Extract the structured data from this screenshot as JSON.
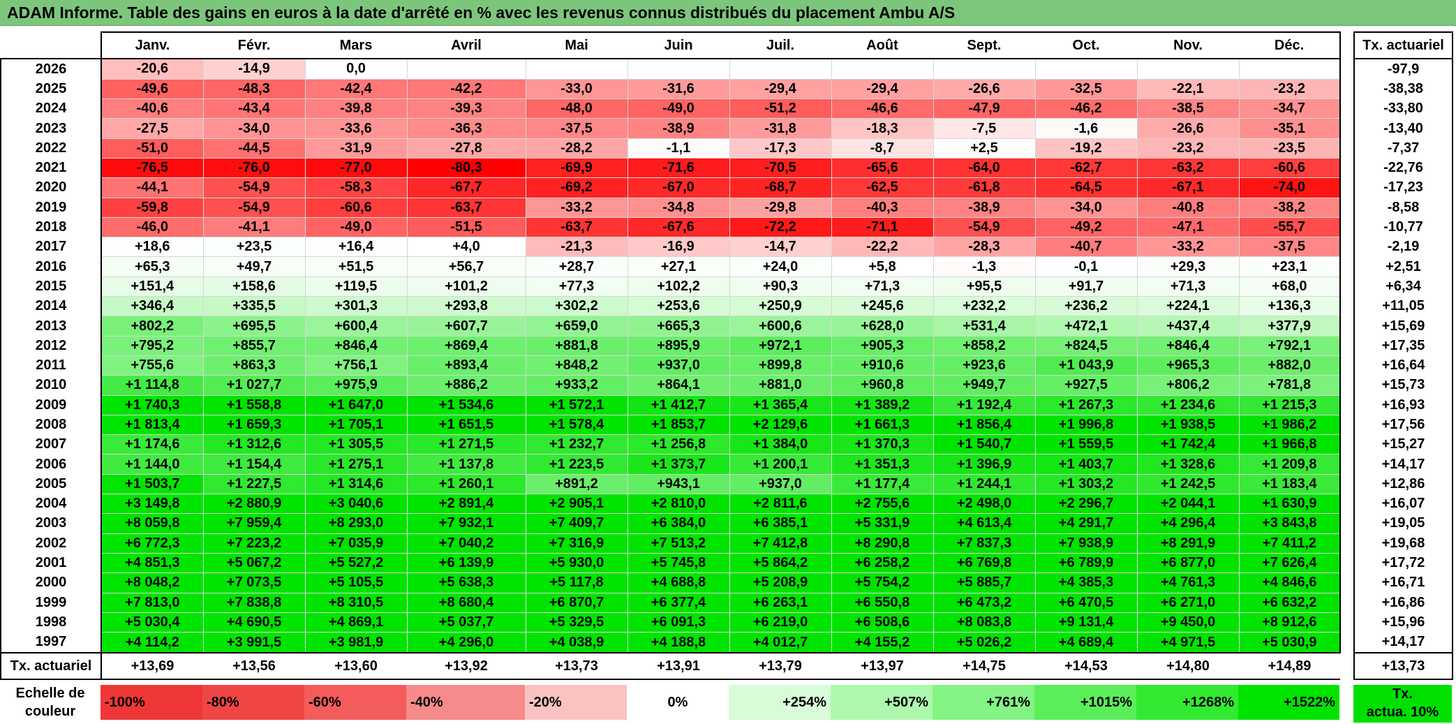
{
  "title": "ADAM Informe. Table des gains en euros à la date d'arrêté en % avec les revenus connus distribués du placement Ambu A/S",
  "months": [
    "Janv.",
    "Févr.",
    "Mars",
    "Avril",
    "Mai",
    "Juin",
    "Juil.",
    "Août",
    "Sept.",
    "Oct.",
    "Nov.",
    "Déc."
  ],
  "side_header": "Tx. actuariel",
  "rows": [
    {
      "year": "2026",
      "values": [
        "-20,6",
        "-14,9",
        "0,0",
        "",
        "",
        "",
        "",
        "",
        "",
        "",
        "",
        ""
      ],
      "tx": "-97,9"
    },
    {
      "year": "2025",
      "values": [
        "-49,6",
        "-48,3",
        "-42,4",
        "-42,2",
        "-33,0",
        "-31,6",
        "-29,4",
        "-29,4",
        "-26,6",
        "-32,5",
        "-22,1",
        "-23,2"
      ],
      "tx": "-38,38"
    },
    {
      "year": "2024",
      "values": [
        "-40,6",
        "-43,4",
        "-39,8",
        "-39,3",
        "-48,0",
        "-49,0",
        "-51,2",
        "-46,6",
        "-47,9",
        "-46,2",
        "-38,5",
        "-34,7"
      ],
      "tx": "-33,80"
    },
    {
      "year": "2023",
      "values": [
        "-27,5",
        "-34,0",
        "-33,6",
        "-36,3",
        "-37,5",
        "-38,9",
        "-31,8",
        "-18,3",
        "-7,5",
        "-1,6",
        "-26,6",
        "-35,1"
      ],
      "tx": "-13,40"
    },
    {
      "year": "2022",
      "values": [
        "-51,0",
        "-44,5",
        "-31,9",
        "-27,8",
        "-28,2",
        "-1,1",
        "-17,3",
        "-8,7",
        "+2,5",
        "-19,2",
        "-23,2",
        "-23,5"
      ],
      "tx": "-7,37"
    },
    {
      "year": "2021",
      "values": [
        "-76,5",
        "-76,0",
        "-77,0",
        "-80,3",
        "-69,9",
        "-71,6",
        "-70,5",
        "-65,6",
        "-64,0",
        "-62,7",
        "-63,2",
        "-60,6"
      ],
      "tx": "-22,76"
    },
    {
      "year": "2020",
      "values": [
        "-44,1",
        "-54,9",
        "-58,3",
        "-67,7",
        "-69,2",
        "-67,0",
        "-68,7",
        "-62,5",
        "-61,8",
        "-64,5",
        "-67,1",
        "-74,0"
      ],
      "tx": "-17,23"
    },
    {
      "year": "2019",
      "values": [
        "-59,8",
        "-54,9",
        "-60,6",
        "-63,7",
        "-33,2",
        "-34,8",
        "-29,8",
        "-40,3",
        "-38,9",
        "-34,0",
        "-40,8",
        "-38,2"
      ],
      "tx": "-8,58"
    },
    {
      "year": "2018",
      "values": [
        "-46,0",
        "-41,1",
        "-49,0",
        "-51,5",
        "-63,7",
        "-67,6",
        "-72,2",
        "-71,1",
        "-54,9",
        "-49,2",
        "-47,1",
        "-55,7"
      ],
      "tx": "-10,77"
    },
    {
      "year": "2017",
      "values": [
        "+18,6",
        "+23,5",
        "+16,4",
        "+4,0",
        "-21,3",
        "-16,9",
        "-14,7",
        "-22,2",
        "-28,3",
        "-40,7",
        "-33,2",
        "-37,5"
      ],
      "tx": "-2,19"
    },
    {
      "year": "2016",
      "values": [
        "+65,3",
        "+49,7",
        "+51,5",
        "+56,7",
        "+28,7",
        "+27,1",
        "+24,0",
        "+5,8",
        "-1,3",
        "-0,1",
        "+29,3",
        "+23,1"
      ],
      "tx": "+2,51"
    },
    {
      "year": "2015",
      "values": [
        "+151,4",
        "+158,6",
        "+119,5",
        "+101,2",
        "+77,3",
        "+102,2",
        "+90,3",
        "+71,3",
        "+95,5",
        "+91,7",
        "+71,3",
        "+68,0"
      ],
      "tx": "+6,34"
    },
    {
      "year": "2014",
      "values": [
        "+346,4",
        "+335,5",
        "+301,3",
        "+293,8",
        "+302,2",
        "+253,6",
        "+250,9",
        "+245,6",
        "+232,2",
        "+236,2",
        "+224,1",
        "+136,3"
      ],
      "tx": "+11,05"
    },
    {
      "year": "2013",
      "values": [
        "+802,2",
        "+695,5",
        "+600,4",
        "+607,7",
        "+659,0",
        "+665,3",
        "+600,6",
        "+628,0",
        "+531,4",
        "+472,1",
        "+437,4",
        "+377,9"
      ],
      "tx": "+15,69"
    },
    {
      "year": "2012",
      "values": [
        "+795,2",
        "+855,7",
        "+846,4",
        "+869,4",
        "+881,8",
        "+895,9",
        "+972,1",
        "+905,3",
        "+858,2",
        "+824,5",
        "+846,4",
        "+792,1"
      ],
      "tx": "+17,35"
    },
    {
      "year": "2011",
      "values": [
        "+755,6",
        "+863,3",
        "+756,1",
        "+893,4",
        "+848,2",
        "+937,0",
        "+899,8",
        "+910,6",
        "+923,6",
        "+1 043,9",
        "+965,3",
        "+882,0"
      ],
      "tx": "+16,64"
    },
    {
      "year": "2010",
      "values": [
        "+1 114,8",
        "+1 027,7",
        "+975,9",
        "+886,2",
        "+933,2",
        "+864,1",
        "+881,0",
        "+960,8",
        "+949,7",
        "+927,5",
        "+806,2",
        "+781,8"
      ],
      "tx": "+15,73"
    },
    {
      "year": "2009",
      "values": [
        "+1 740,3",
        "+1 558,8",
        "+1 647,0",
        "+1 534,6",
        "+1 572,1",
        "+1 412,7",
        "+1 365,4",
        "+1 389,2",
        "+1 192,4",
        "+1 267,3",
        "+1 234,6",
        "+1 215,3"
      ],
      "tx": "+16,93"
    },
    {
      "year": "2008",
      "values": [
        "+1 813,4",
        "+1 659,3",
        "+1 705,1",
        "+1 651,5",
        "+1 578,4",
        "+1 853,7",
        "+2 129,6",
        "+1 661,3",
        "+1 856,4",
        "+1 996,8",
        "+1 938,5",
        "+1 986,2"
      ],
      "tx": "+17,56"
    },
    {
      "year": "2007",
      "values": [
        "+1 174,6",
        "+1 312,6",
        "+1 305,5",
        "+1 271,5",
        "+1 232,7",
        "+1 256,8",
        "+1 384,0",
        "+1 370,3",
        "+1 540,7",
        "+1 559,5",
        "+1 742,4",
        "+1 966,8"
      ],
      "tx": "+15,27"
    },
    {
      "year": "2006",
      "values": [
        "+1 144,0",
        "+1 154,4",
        "+1 275,1",
        "+1 137,8",
        "+1 223,5",
        "+1 373,7",
        "+1 200,1",
        "+1 351,3",
        "+1 396,9",
        "+1 403,7",
        "+1 328,6",
        "+1 209,8"
      ],
      "tx": "+14,17"
    },
    {
      "year": "2005",
      "values": [
        "+1 503,7",
        "+1 227,5",
        "+1 314,6",
        "+1 260,1",
        "+891,2",
        "+943,1",
        "+937,0",
        "+1 177,4",
        "+1 244,1",
        "+1 303,2",
        "+1 242,5",
        "+1 183,4"
      ],
      "tx": "+12,86"
    },
    {
      "year": "2004",
      "values": [
        "+3 149,8",
        "+2 880,9",
        "+3 040,6",
        "+2 891,4",
        "+2 905,1",
        "+2 810,0",
        "+2 811,6",
        "+2 755,6",
        "+2 498,0",
        "+2 296,7",
        "+2 044,1",
        "+1 630,9"
      ],
      "tx": "+16,07"
    },
    {
      "year": "2003",
      "values": [
        "+8 059,8",
        "+7 959,4",
        "+8 293,0",
        "+7 932,1",
        "+7 409,7",
        "+6 384,0",
        "+6 385,1",
        "+5 331,9",
        "+4 613,4",
        "+4 291,7",
        "+4 296,4",
        "+3 843,8"
      ],
      "tx": "+19,05"
    },
    {
      "year": "2002",
      "values": [
        "+6 772,3",
        "+7 223,2",
        "+7 035,9",
        "+7 040,2",
        "+7 316,9",
        "+7 513,2",
        "+7 412,8",
        "+8 290,8",
        "+7 837,3",
        "+7 938,9",
        "+8 291,9",
        "+7 411,2"
      ],
      "tx": "+19,68"
    },
    {
      "year": "2001",
      "values": [
        "+4 851,3",
        "+5 067,2",
        "+5 527,2",
        "+6 139,9",
        "+5 930,0",
        "+5 745,8",
        "+5 864,2",
        "+6 258,2",
        "+6 769,8",
        "+6 789,9",
        "+6 877,0",
        "+7 626,4"
      ],
      "tx": "+17,72"
    },
    {
      "year": "2000",
      "values": [
        "+8 048,2",
        "+7 073,5",
        "+5 105,5",
        "+5 638,3",
        "+5 117,8",
        "+4 688,8",
        "+5 208,9",
        "+5 754,2",
        "+5 885,7",
        "+4 385,3",
        "+4 761,3",
        "+4 846,6"
      ],
      "tx": "+16,71"
    },
    {
      "year": "1999",
      "values": [
        "+7 813,0",
        "+7 838,8",
        "+8 310,5",
        "+8 680,4",
        "+6 870,7",
        "+6 377,4",
        "+6 263,1",
        "+6 550,8",
        "+6 473,2",
        "+6 470,5",
        "+6 271,0",
        "+6 632,2"
      ],
      "tx": "+16,86"
    },
    {
      "year": "1998",
      "values": [
        "+5 030,4",
        "+4 690,5",
        "+4 869,1",
        "+5 037,7",
        "+5 329,5",
        "+6 091,3",
        "+6 219,0",
        "+6 508,6",
        "+8 083,8",
        "+9 131,4",
        "+9 450,0",
        "+8 912,6"
      ],
      "tx": "+15,96"
    },
    {
      "year": "1997",
      "values": [
        "+4 114,2",
        "+3 991,5",
        "+3 981,9",
        "+4 296,0",
        "+4 038,9",
        "+4 188,8",
        "+4 012,7",
        "+4 155,2",
        "+5 026,2",
        "+4 689,4",
        "+4 971,5",
        "+5 030,9"
      ],
      "tx": "+14,17"
    }
  ],
  "footer": {
    "label": "Tx. actuariel",
    "values": [
      "+13,69",
      "+13,56",
      "+13,60",
      "+13,92",
      "+13,73",
      "+13,91",
      "+13,79",
      "+13,97",
      "+14,75",
      "+14,53",
      "+14,80",
      "+14,89"
    ],
    "tx": "+13,73"
  },
  "legend": {
    "label": "Echelle de couleur",
    "steps": [
      {
        "text": "-100%",
        "color": "#ef3737",
        "align": "l"
      },
      {
        "text": "-80%",
        "color": "#f04545",
        "align": "l"
      },
      {
        "text": "-60%",
        "color": "#f45c5c",
        "align": "l"
      },
      {
        "text": "-40%",
        "color": "#f78a8a",
        "align": "l"
      },
      {
        "text": "-20%",
        "color": "#fbc2c2",
        "align": "l"
      },
      {
        "text": "0%",
        "color": "#ffffff",
        "align": "c"
      },
      {
        "text": "+254%",
        "color": "#d8fcd8",
        "align": "r"
      },
      {
        "text": "+507%",
        "color": "#aef8ae",
        "align": "r"
      },
      {
        "text": "+761%",
        "color": "#84f484",
        "align": "r"
      },
      {
        "text": "+1015%",
        "color": "#5aef5a",
        "align": "r"
      },
      {
        "text": "+1268%",
        "color": "#32ea32",
        "align": "r"
      },
      {
        "text": "+1522%",
        "color": "#00e400",
        "align": "r"
      }
    ],
    "tx_label_1": "Tx.",
    "tx_label_2": "actua. 10%"
  },
  "colors": {
    "title_bg": "#7cc67c",
    "max_green": "#00e400",
    "max_red": "#ff0000"
  }
}
